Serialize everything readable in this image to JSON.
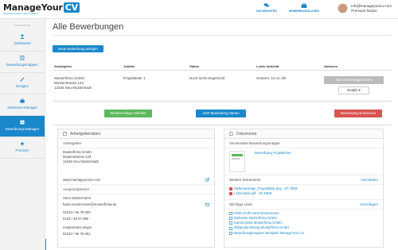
{
  "header": {
    "logo_text": "ManageYour",
    "logo_cv": "CV",
    "logo_tagline": "Jobsuche besser, Leben leichter.",
    "nav": [
      {
        "label": "NACHRICHTEN",
        "icon": "chat-icon"
      },
      {
        "label": "BEWERBUNGSLAGEN",
        "icon": "briefcase-icon"
      }
    ],
    "user_email": "info@manageyourcv.com",
    "user_plan": "Premium-Nutzer"
  },
  "sidebar": {
    "heading": "NAVIGATION",
    "items": [
      {
        "label": "Dashboard",
        "icon": "user-icon"
      },
      {
        "label": "Bewerbungsmappen",
        "icon": "document-icon"
      },
      {
        "label": "Designs",
        "icon": "brush-icon"
      },
      {
        "label": "Jobbörsen-Manager",
        "icon": "briefcase-icon"
      },
      {
        "label": "Bewerbungs-Manager",
        "icon": "list-icon",
        "active": true
      },
      {
        "label": "Premium",
        "icon": "star-icon"
      }
    ],
    "toggle": "›"
  },
  "main": {
    "title": "Alle Bewerbungen",
    "new_button": "Neue Bewerbung anlegen",
    "table": {
      "headers": [
        "Arbeitgeber",
        "Jobtitel",
        "Status",
        "Letzte Aktivität",
        "Aktionen"
      ],
      "row": {
        "employer_lines": [
          "Musterfirma GmbH",
          "Musterstrasse 123",
          "12345 Neu Musterstadt"
        ],
        "jobtitle": "Projektleiter 1",
        "status": "Noch nicht eingereicht",
        "last_activity": "Gestern, 14:11 Uhr",
        "status_button": "Noch nicht eingereicht ▾",
        "details_button": "Details ▾"
      }
    },
    "actions": {
      "reminder": "Wiedervorlage erstellen",
      "start": "Jetzt Bewerbung starten",
      "archive": "Bewerbung archivieren"
    }
  },
  "left_panel": {
    "title": "Arbeitgeberdaten",
    "employer_heading": "Arbeitgeber",
    "employer_lines": [
      "Musterfirma GmbH",
      "Musterstrasse 123",
      "12345 Neu Musterstadt"
    ],
    "website": "www.manageyourcv.com",
    "contact_heading": "Ansprechpartner",
    "contact_name": "Hans Mustermann",
    "contact_email": "hans.mustermann@musterfirma.de",
    "phone1": "01234 / 56 78 900",
    "phone2": "0123 / 45 67 890",
    "skype": "mustermann.skype",
    "phone3": "01234 / 56 78 901"
  },
  "right_panel": {
    "title": "Dokumente",
    "used_heading": "Verwendete Bewerbungsmappe",
    "used_link": "Bewerbung Projektleiter",
    "more_heading": "Weitere Dokumente",
    "upload_link": "Hochladen",
    "documents": [
      "Stellenanzeige_Projektleiter.png - 97.79KB",
      "Lebenslauf.pdf - 30.49KB"
    ],
    "links_heading": "Wichtige Links",
    "add_link": "Hinzufügen",
    "links": [
      "XING Profil Hans Mustermann",
      "Webseite Musterfirma GmbH",
      "Karriereseite Musterfirma GmbH",
      "Wikipedia Eintrag Musterfirma GmbH",
      "Bewerbungsmappen Beispiele ManageYour CV"
    ]
  },
  "colors": {
    "accent": "#1a88ca",
    "success": "#5cb85c",
    "danger": "#d9534f"
  }
}
